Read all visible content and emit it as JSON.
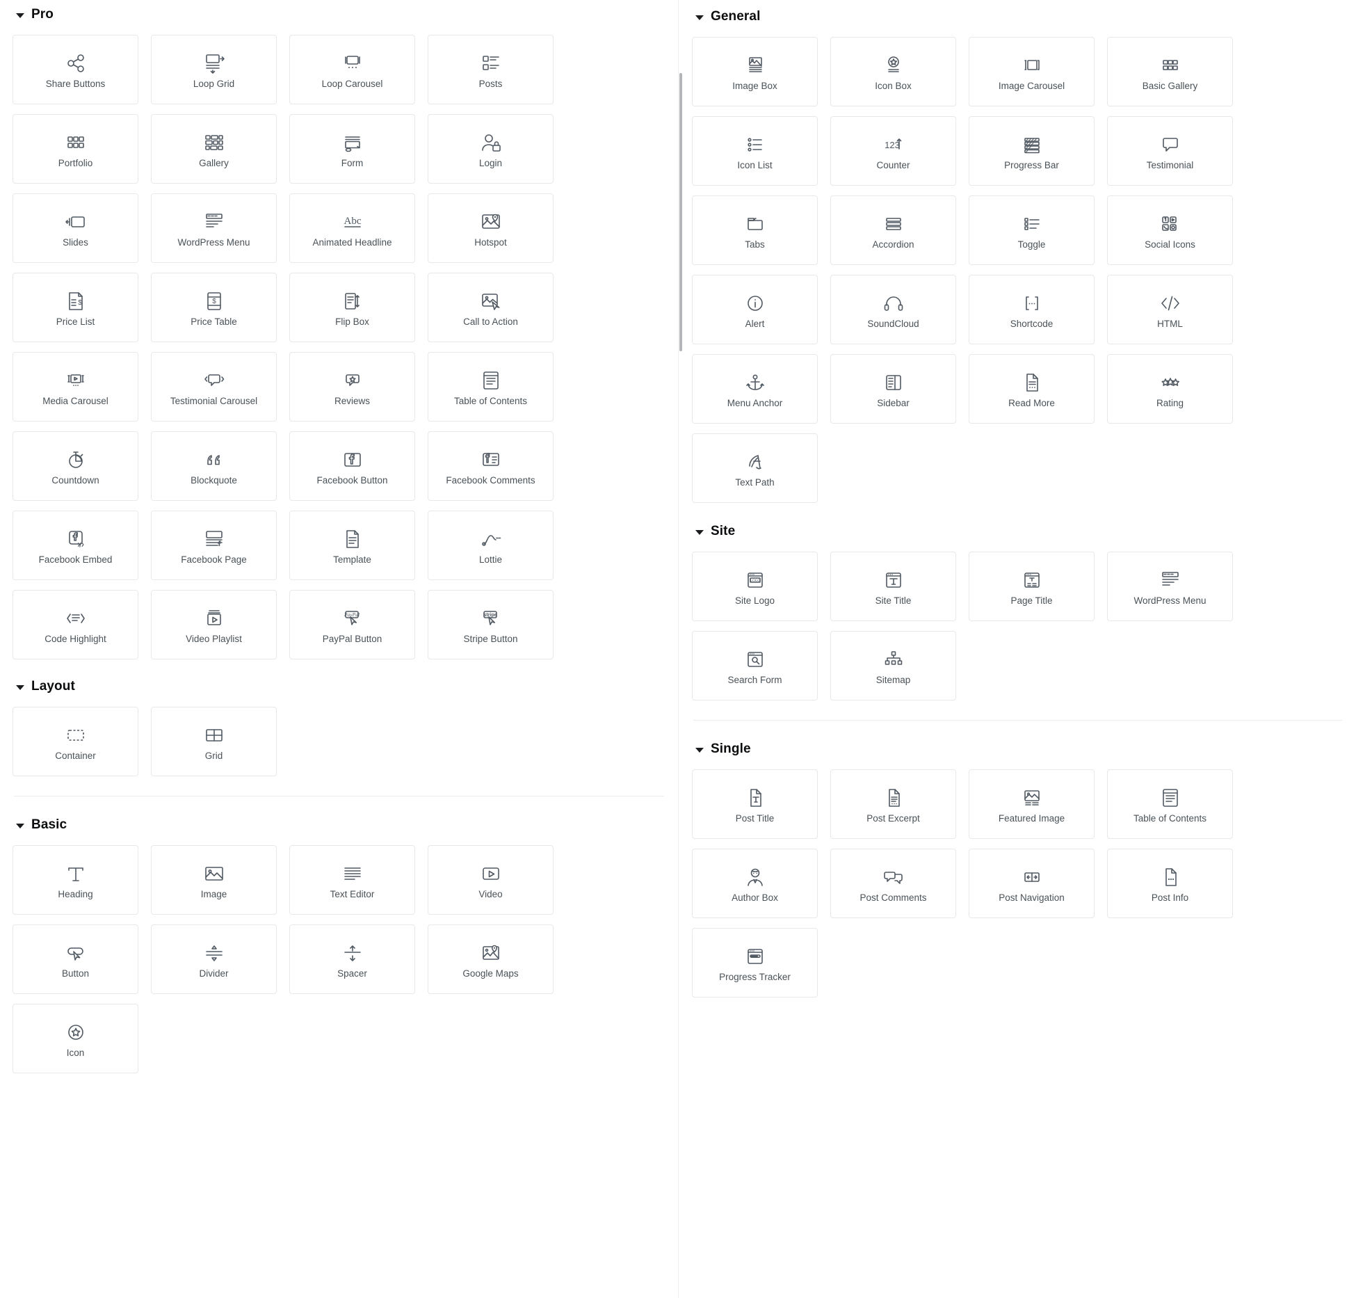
{
  "panel": {
    "scrollbar": {
      "name": "widget-panel-scrollbar"
    }
  },
  "sections": {
    "pro": {
      "title": "Pro"
    },
    "layout": {
      "title": "Layout"
    },
    "basic": {
      "title": "Basic"
    },
    "general": {
      "title": "General"
    },
    "site": {
      "title": "Site"
    },
    "single": {
      "title": "Single"
    }
  },
  "widgets": {
    "pro": [
      {
        "label": "Share Buttons",
        "icon": "share-icon"
      },
      {
        "label": "Loop Grid",
        "icon": "loop-grid-icon"
      },
      {
        "label": "Loop Carousel",
        "icon": "loop-carousel-icon"
      },
      {
        "label": "Posts",
        "icon": "posts-icon"
      },
      {
        "label": "Portfolio",
        "icon": "portfolio-icon"
      },
      {
        "label": "Gallery",
        "icon": "gallery-icon"
      },
      {
        "label": "Form",
        "icon": "form-icon"
      },
      {
        "label": "Login",
        "icon": "login-icon"
      },
      {
        "label": "Slides",
        "icon": "slides-icon"
      },
      {
        "label": "WordPress Menu",
        "icon": "wordpress-menu-icon"
      },
      {
        "label": "Animated Headline",
        "icon": "animated-headline-icon"
      },
      {
        "label": "Hotspot",
        "icon": "hotspot-icon"
      },
      {
        "label": "Price List",
        "icon": "price-list-icon"
      },
      {
        "label": "Price Table",
        "icon": "price-table-icon"
      },
      {
        "label": "Flip Box",
        "icon": "flip-box-icon"
      },
      {
        "label": "Call to Action",
        "icon": "call-to-action-icon"
      },
      {
        "label": "Media Carousel",
        "icon": "media-carousel-icon"
      },
      {
        "label": "Testimonial Carousel",
        "icon": "testimonial-carousel-icon"
      },
      {
        "label": "Reviews",
        "icon": "reviews-icon"
      },
      {
        "label": "Table of Contents",
        "icon": "table-of-contents-icon"
      },
      {
        "label": "Countdown",
        "icon": "countdown-icon"
      },
      {
        "label": "Blockquote",
        "icon": "blockquote-icon"
      },
      {
        "label": "Facebook Button",
        "icon": "facebook-button-icon"
      },
      {
        "label": "Facebook Comments",
        "icon": "facebook-comments-icon"
      },
      {
        "label": "Facebook Embed",
        "icon": "facebook-embed-icon"
      },
      {
        "label": "Facebook Page",
        "icon": "facebook-page-icon"
      },
      {
        "label": "Template",
        "icon": "template-icon"
      },
      {
        "label": "Lottie",
        "icon": "lottie-icon"
      },
      {
        "label": "Code Highlight",
        "icon": "code-highlight-icon"
      },
      {
        "label": "Video Playlist",
        "icon": "video-playlist-icon"
      },
      {
        "label": "PayPal Button",
        "icon": "paypal-button-icon"
      },
      {
        "label": "Stripe Button",
        "icon": "stripe-button-icon"
      }
    ],
    "layout": [
      {
        "label": "Container",
        "icon": "container-icon"
      },
      {
        "label": "Grid",
        "icon": "grid-icon"
      }
    ],
    "basic": [
      {
        "label": "Heading",
        "icon": "heading-icon"
      },
      {
        "label": "Image",
        "icon": "image-icon"
      },
      {
        "label": "Text Editor",
        "icon": "text-editor-icon"
      },
      {
        "label": "Video",
        "icon": "video-icon"
      },
      {
        "label": "Button",
        "icon": "button-icon"
      },
      {
        "label": "Divider",
        "icon": "divider-icon"
      },
      {
        "label": "Spacer",
        "icon": "spacer-icon"
      },
      {
        "label": "Google Maps",
        "icon": "google-maps-icon"
      },
      {
        "label": "Icon",
        "icon": "icon-star-icon"
      }
    ],
    "general": [
      {
        "label": "Image Box",
        "icon": "image-box-icon"
      },
      {
        "label": "Icon Box",
        "icon": "icon-box-icon"
      },
      {
        "label": "Image Carousel",
        "icon": "image-carousel-icon"
      },
      {
        "label": "Basic Gallery",
        "icon": "basic-gallery-icon"
      },
      {
        "label": "Icon List",
        "icon": "icon-list-icon"
      },
      {
        "label": "Counter",
        "icon": "counter-icon"
      },
      {
        "label": "Progress Bar",
        "icon": "progress-bar-icon"
      },
      {
        "label": "Testimonial",
        "icon": "testimonial-icon"
      },
      {
        "label": "Tabs",
        "icon": "tabs-icon"
      },
      {
        "label": "Accordion",
        "icon": "accordion-icon"
      },
      {
        "label": "Toggle",
        "icon": "toggle-icon"
      },
      {
        "label": "Social Icons",
        "icon": "social-icons-icon"
      },
      {
        "label": "Alert",
        "icon": "alert-icon"
      },
      {
        "label": "SoundCloud",
        "icon": "soundcloud-icon"
      },
      {
        "label": "Shortcode",
        "icon": "shortcode-icon"
      },
      {
        "label": "HTML",
        "icon": "html-icon"
      },
      {
        "label": "Menu Anchor",
        "icon": "menu-anchor-icon"
      },
      {
        "label": "Sidebar",
        "icon": "sidebar-icon"
      },
      {
        "label": "Read More",
        "icon": "read-more-icon"
      },
      {
        "label": "Rating",
        "icon": "rating-icon"
      },
      {
        "label": "Text Path",
        "icon": "text-path-icon"
      }
    ],
    "site": [
      {
        "label": "Site Logo",
        "icon": "site-logo-icon"
      },
      {
        "label": "Site Title",
        "icon": "site-title-icon"
      },
      {
        "label": "Page Title",
        "icon": "page-title-icon"
      },
      {
        "label": "WordPress Menu",
        "icon": "wordpress-menu-icon"
      },
      {
        "label": "Search Form",
        "icon": "search-form-icon"
      },
      {
        "label": "Sitemap",
        "icon": "sitemap-icon"
      }
    ],
    "single": [
      {
        "label": "Post Title",
        "icon": "post-title-icon"
      },
      {
        "label": "Post Excerpt",
        "icon": "post-excerpt-icon"
      },
      {
        "label": "Featured Image",
        "icon": "featured-image-icon"
      },
      {
        "label": "Table of Contents",
        "icon": "table-of-contents-icon"
      },
      {
        "label": "Author Box",
        "icon": "author-box-icon"
      },
      {
        "label": "Post Comments",
        "icon": "post-comments-icon"
      },
      {
        "label": "Post Navigation",
        "icon": "post-navigation-icon"
      },
      {
        "label": "Post Info",
        "icon": "post-info-icon"
      },
      {
        "label": "Progress Tracker",
        "icon": "progress-tracker-icon"
      }
    ]
  },
  "colors": {
    "card_border": "#e6e8ea",
    "label_text": "#495157",
    "icon_stroke": "#515962",
    "heading_text": "#0c0d0e",
    "divider": "#ebecec"
  }
}
